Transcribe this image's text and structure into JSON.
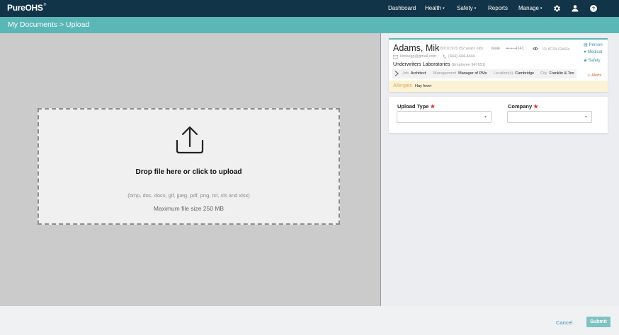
{
  "app": {
    "logo": "PureOHS",
    "logo_mark": "®"
  },
  "nav": {
    "items": [
      {
        "label": "Dashboard",
        "has_caret": false
      },
      {
        "label": "Health",
        "has_caret": true
      },
      {
        "label": "Safety",
        "has_caret": true
      },
      {
        "label": "Reports",
        "has_caret": false
      },
      {
        "label": "Manage",
        "has_caret": true
      }
    ],
    "caret": "▾",
    "icons": [
      "gear-icon",
      "user-icon",
      "help-icon"
    ]
  },
  "breadcrumb": "My Documents > Upload",
  "upload": {
    "title": "Drop file here or click to upload",
    "types": "(bmp, doc, docx, gif, jpeg, pdf, png, txt, xls and xlsx)",
    "max_size": "Maximum file size 250 MB"
  },
  "person": {
    "name": "Adams, Mik",
    "dob": "03/01/1970 (52 years old)",
    "sex": "Male",
    "ssn": "•••-••-4141",
    "id": "ID: 8C3A-62e66e",
    "email": "kimkegg@gmail.com",
    "phone": "(444) 444-4444",
    "company": "Underwriters Laboratories",
    "employee": "(Employee 947651)",
    "details": [
      {
        "key": "Job",
        "value": "Architect"
      },
      {
        "key": "Management",
        "value": "Manager of PMs"
      },
      {
        "key": "Location(s)",
        "value": "Cambridge"
      },
      {
        "key": "City",
        "value": "Franklin & Ten"
      }
    ],
    "links": [
      "Person",
      "Medical",
      "Safety"
    ],
    "alerts": "Alerts",
    "allergies_label": "Allergies",
    "allergies_value": "Hay fever"
  },
  "form": {
    "upload_type_label": "Upload Type",
    "company_label": "Company",
    "required_mark": "★",
    "select_arrow": "▾"
  },
  "footer": {
    "cancel": "Cancel",
    "submit": "Submit"
  },
  "colors": {
    "nav_bg": "#123448",
    "accent": "#5ab7b5",
    "link": "#3f8fb5",
    "required": "#d9302c"
  }
}
